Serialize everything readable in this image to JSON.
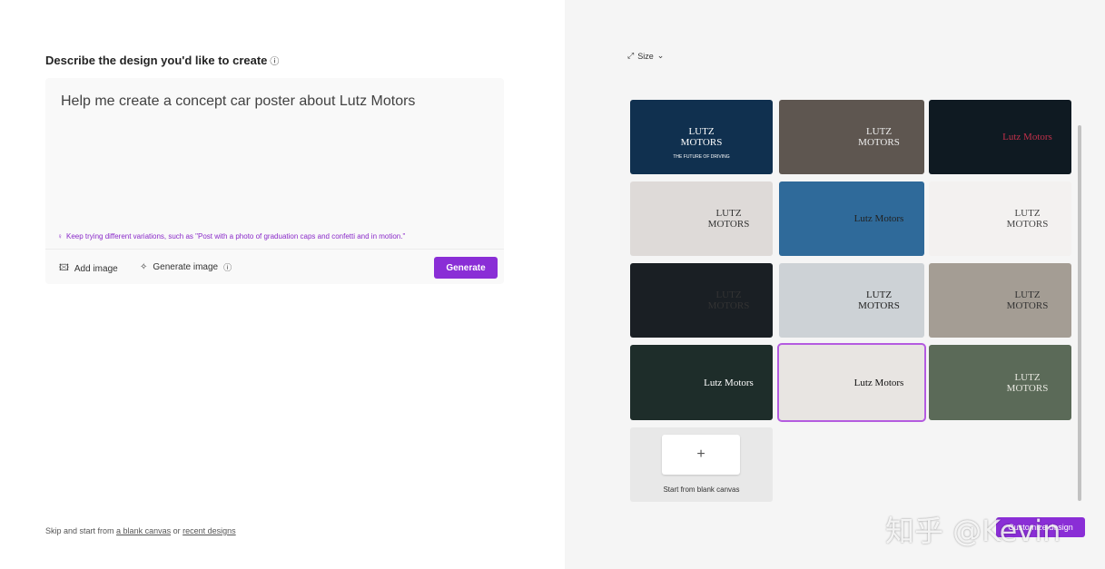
{
  "left": {
    "title": "Describe the design you'd like to create",
    "info_icon": "info-icon",
    "prompt": "Help me create a concept car poster about Lutz Motors",
    "tip": "Keep trying different variations, such as \"Post with a photo of graduation caps and confetti and in motion.\"",
    "add_image": "Add image",
    "generate_image": "Generate image",
    "generate": "Generate",
    "skip_prefix": "Skip and start from",
    "blank_canvas_link": "a blank canvas",
    "or": "or",
    "recent_designs_link": "recent designs",
    "accent": "#8a2ed6"
  },
  "right": {
    "size_label": "Size",
    "cards": [
      {
        "text": "",
        "sub": "",
        "bg": "#8a5a3a",
        "color": "#fff"
      },
      {
        "text": "",
        "sub": "",
        "bg": "#0d1a4a",
        "color": "#fff"
      },
      {
        "text": "",
        "sub": "",
        "bg": "#ffffff",
        "color": "#333"
      },
      {
        "text": "LUTZ MOTORS",
        "sub": "THE FUTURE OF DRIVING",
        "bg": "#10304f",
        "color": "#fff"
      },
      {
        "text": "LUTZ MOTORS",
        "sub": "",
        "bg": "#5e5650",
        "color": "#eee"
      },
      {
        "text": "Lutz Motors",
        "sub": "",
        "bg": "#0f1a22",
        "color": "#c0304a"
      },
      {
        "text": "LUTZ MOTORS",
        "sub": "",
        "bg": "#dedad8",
        "color": "#333"
      },
      {
        "text": "Lutz Motors",
        "sub": "",
        "bg": "#2f6a9a",
        "color": "#222"
      },
      {
        "text": "LUTZ MOTORS",
        "sub": "",
        "bg": "#f3f1f0",
        "color": "#444"
      },
      {
        "text": "LUTZ MOTORS",
        "sub": "",
        "bg": "#1a1f24",
        "color": "#333"
      },
      {
        "text": "LUTZ MOTORS",
        "sub": "",
        "bg": "#cdd2d6",
        "color": "#222"
      },
      {
        "text": "LUTZ MOTORS",
        "sub": "",
        "bg": "#a49d94",
        "color": "#333"
      },
      {
        "text": "Lutz Motors",
        "sub": "",
        "bg": "#1e2d2a",
        "color": "#fff"
      },
      {
        "text": "Lutz Motors",
        "sub": "",
        "bg": "#e8e5e2",
        "color": "#111"
      },
      {
        "text": "LUTZ MOTORS",
        "sub": "",
        "bg": "#5b6a58",
        "color": "#e8e8e0"
      }
    ],
    "blank_canvas": "Start from blank canvas",
    "customize": "Customize design",
    "watermark": "知乎 @Kevin"
  }
}
